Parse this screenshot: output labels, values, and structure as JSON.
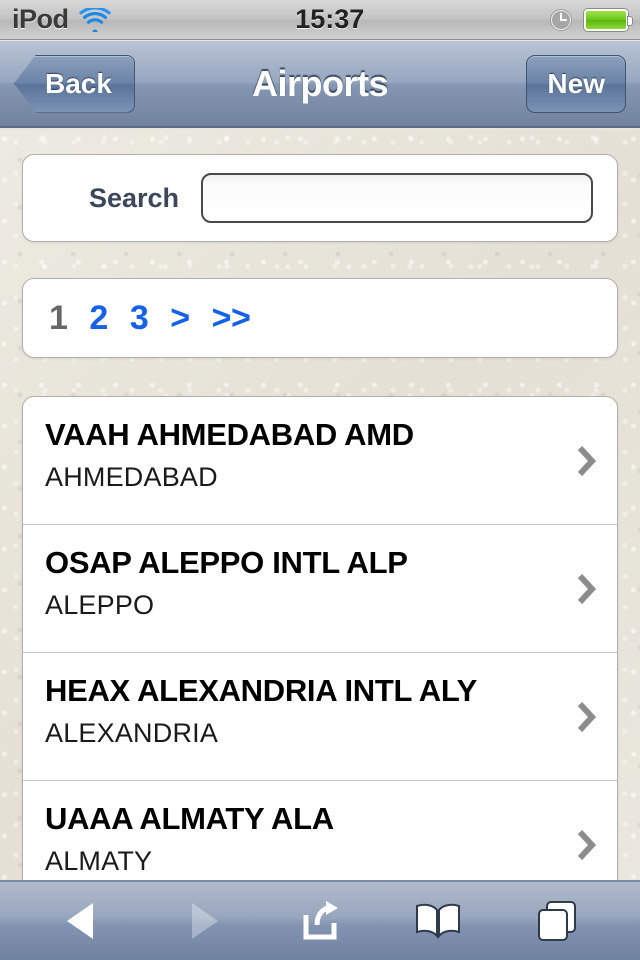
{
  "status_bar": {
    "carrier": "iPod",
    "wifi_icon": "wifi-icon",
    "time": "15:37",
    "alarm_icon": "clock-icon",
    "battery_icon": "battery-icon",
    "battery_color": "#6fc81b"
  },
  "nav_bar": {
    "back_label": "Back",
    "title": "Airports",
    "new_label": "New"
  },
  "search": {
    "label": "Search",
    "value": "",
    "placeholder": ""
  },
  "pagination": {
    "items": [
      {
        "label": "1",
        "state": "current"
      },
      {
        "label": "2",
        "state": "link"
      },
      {
        "label": "3",
        "state": "link"
      },
      {
        "label": ">",
        "state": "link"
      },
      {
        "label": ">>",
        "state": "link"
      }
    ]
  },
  "list": {
    "rows": [
      {
        "title": "VAAH AHMEDABAD AMD",
        "subtitle": "AHMEDABAD"
      },
      {
        "title": "OSAP ALEPPO INTL ALP",
        "subtitle": "ALEPPO"
      },
      {
        "title": "HEAX ALEXANDRIA INTL ALY",
        "subtitle": "ALEXANDRIA"
      },
      {
        "title": "UAAA ALMATY ALA",
        "subtitle": "ALMATY"
      }
    ],
    "chevron_icon": "chevron-right-icon"
  },
  "toolbar": {
    "buttons": [
      {
        "icon": "back-triangle-icon",
        "enabled": true
      },
      {
        "icon": "forward-triangle-icon",
        "enabled": false
      },
      {
        "icon": "share-icon",
        "enabled": true
      },
      {
        "icon": "bookmarks-book-icon",
        "enabled": true
      },
      {
        "icon": "tabs-pages-icon",
        "enabled": true
      }
    ]
  },
  "colors": {
    "link_blue": "#1561e8",
    "page_background": "#e7e4da",
    "nav_bar_top": "#b9c4d4",
    "nav_bar_bottom": "#70839f"
  }
}
